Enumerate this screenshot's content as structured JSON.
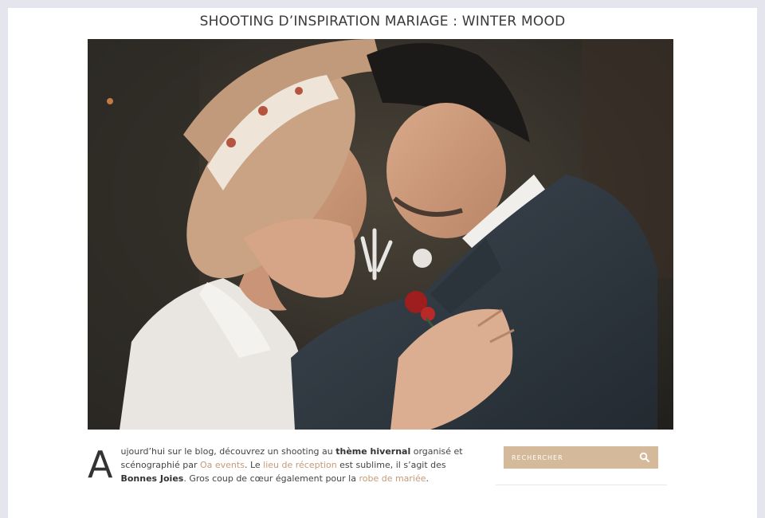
{
  "post": {
    "title": "SHOOTING D’INSPIRATION MARIAGE : WINTER MOOD"
  },
  "article": {
    "dropcap": "A",
    "p1": "ujourd’hui sur le blog, découvrez un shooting au ",
    "b1": "thème hivernal",
    "p2": " organisé et scénographié par ",
    "link1": "Oa events",
    "p3": ". Le ",
    "link2": "lieu de réception",
    "p4": " est sublime, il s’agit des ",
    "b2": "Bonnes Joies",
    "p5": ". Gros coup de cœur également pour la ",
    "link3": "robe de mariée",
    "p6": "."
  },
  "sidebar": {
    "search_placeholder": "RECHERCHER"
  },
  "colors": {
    "accent": "#c59a78",
    "search_bg": "#d4b99a",
    "frame_bg": "#e4e5ed"
  },
  "icons": {
    "search": "magnifier-icon"
  }
}
